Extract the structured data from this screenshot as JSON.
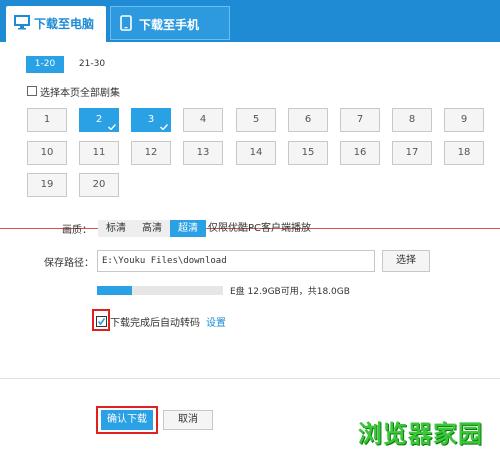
{
  "tabs": {
    "pc_label": "下载至电脑",
    "phone_label": "下载至手机"
  },
  "page_tabs": [
    "1-20",
    "21-30"
  ],
  "select_all_label": "选择本页全部剧集",
  "episodes": [
    {
      "n": "1",
      "selected": false
    },
    {
      "n": "2",
      "selected": true
    },
    {
      "n": "3",
      "selected": true
    },
    {
      "n": "4",
      "selected": false
    },
    {
      "n": "5",
      "selected": false
    },
    {
      "n": "6",
      "selected": false
    },
    {
      "n": "7",
      "selected": false
    },
    {
      "n": "8",
      "selected": false
    },
    {
      "n": "9",
      "selected": false
    },
    {
      "n": "10",
      "selected": false
    },
    {
      "n": "11",
      "selected": false
    },
    {
      "n": "12",
      "selected": false
    },
    {
      "n": "13",
      "selected": false
    },
    {
      "n": "14",
      "selected": false
    },
    {
      "n": "15",
      "selected": false
    },
    {
      "n": "16",
      "selected": false
    },
    {
      "n": "17",
      "selected": false
    },
    {
      "n": "18",
      "selected": false
    },
    {
      "n": "19",
      "selected": false
    },
    {
      "n": "20",
      "selected": false
    }
  ],
  "quality": {
    "label": "画质：",
    "options": [
      "标清",
      "高清",
      "超清"
    ],
    "selected_index": 2,
    "note": "仅限优酷PC客户端播放"
  },
  "save": {
    "label": "保存路径：",
    "path": "E:\\Youku Files\\download",
    "browse_label": "选择"
  },
  "disk": {
    "text": "E盘 12.9GB可用，共18.0GB",
    "used_fraction": 0.28
  },
  "transcode": {
    "label": "下载完成后自动转码",
    "checked": true,
    "settings_link": "设置"
  },
  "buttons": {
    "confirm": "确认下载",
    "cancel": "取消"
  },
  "watermark": "浏览器家园",
  "colors": {
    "accent": "#2aa1e5",
    "header": "#1e8bd4",
    "highlight": "#e02020",
    "watermark": "#3cc63c"
  }
}
